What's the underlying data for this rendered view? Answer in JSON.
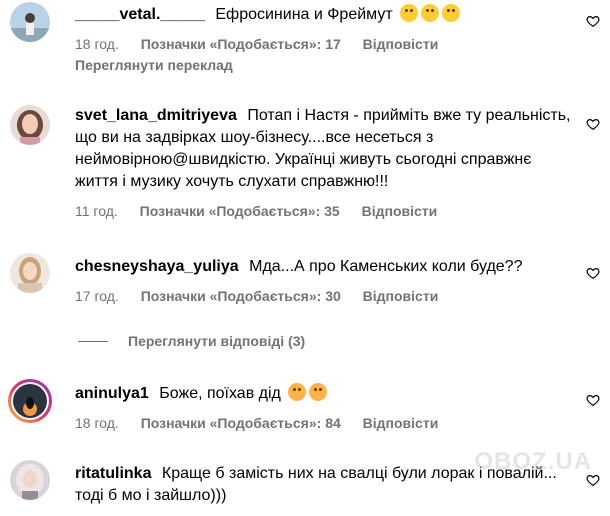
{
  "comments": [
    {
      "username": "_____vetal._____",
      "text": "Ефросинина и Фреймут",
      "emoji_count": 3,
      "time": "18 год.",
      "likes": "Позначки «Подобається»: 17",
      "reply": "Відповісти",
      "translate": "Переглянути переклад"
    },
    {
      "username": "svet_lana_dmitriyeva",
      "text": "Потап і Настя - прийміть вже ту реальність, що ви на задвірках шоу-бізнесу....все несеться з неймовірною@швидкістю. Українці живуть сьогодні справжнє життя і музику хочуть слухати справжню!!!",
      "time": "11 год.",
      "likes": "Позначки «Подобається»: 35",
      "reply": "Відповісти"
    },
    {
      "username": "chesneyshaya_yuliya",
      "text": "Мда...А про Каменських коли буде??",
      "time": "17 год.",
      "likes": "Позначки «Подобається»: 30",
      "reply": "Відповісти",
      "view_replies": "Переглянути відповіді (3)"
    },
    {
      "username": "aninulya1",
      "text": "Боже, поїхав дід",
      "emoji_count": 2,
      "time": "18 год.",
      "likes": "Позначки «Подобається»: 84",
      "reply": "Відповісти"
    },
    {
      "username": "ritatulinka",
      "text": "Краще б замість них на свалці були лорак і повалій... тоді б мо і зайшло)))"
    }
  ],
  "watermark": "OBOZ.UA",
  "colors": {
    "meta": "#737373",
    "text": "#000000"
  }
}
